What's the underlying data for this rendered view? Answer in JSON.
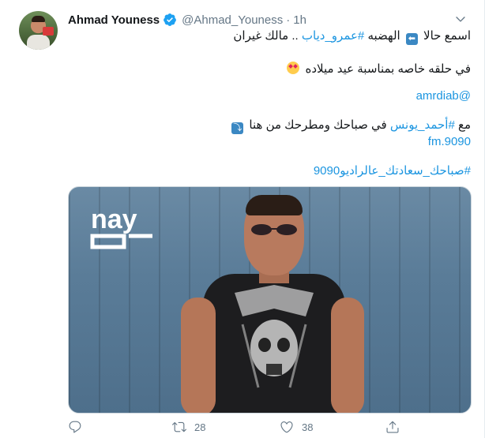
{
  "tweet": {
    "author_name": "Ahmad Youness",
    "handle": "@Ahmad_Youness",
    "dot": "·",
    "time": "1h",
    "line1_a": "اسمع حالا",
    "line1_b": "الهضبه",
    "line1_tag": "#عمرو_دياب",
    "line1_c": ".. مالك غيران",
    "line2": "في حلقه خاصه بمناسبة عيد ميلاده",
    "mention": "@amrdiab",
    "line4_a": "مع",
    "line4_tag": "#أحمد_يونس",
    "line4_b": "في صباحك ومطرحك من هنا",
    "link": "9090.fm",
    "hashtag": "#صباحك_سعادتك_عالراديو9090",
    "image_logo_text": "nay"
  },
  "actions": {
    "reply_count": "",
    "retweet_count": "28",
    "like_count": "38",
    "share_count": ""
  },
  "icons": {
    "avatar": "avatar",
    "verified": "verified-badge-icon",
    "caret": "chevron-down-icon",
    "reply": "reply-icon",
    "retweet": "retweet-icon",
    "like": "heart-icon",
    "share": "share-icon"
  },
  "colors": {
    "link": "#1b95e0",
    "secondary": "#657786",
    "verified": "#1da1f2"
  }
}
